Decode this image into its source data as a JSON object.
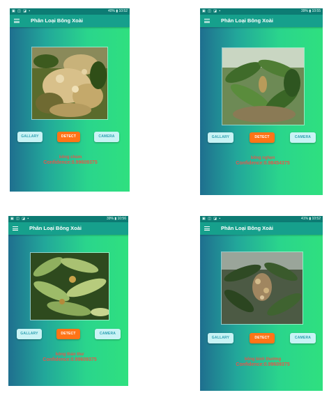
{
  "app_title": "Phân Loại Bông Xoài",
  "buttons": {
    "gallery": "GALLARY",
    "detect": "DETECT",
    "camera": "CAMERA"
  },
  "screens": [
    {
      "status_right": "40% ▮ 10:52",
      "status_left": "▣ ◫ ◪ ▪",
      "result_label": "bông chùm",
      "confidence": "Confidence:0.99609375",
      "image_desc": "mango-flower-cluster-photo"
    },
    {
      "status_right": "39% ▮ 10:55",
      "status_left": "▣ ◫ ◪ ▪",
      "result_label": "bông nghẹn",
      "confidence": "Confidence:0.98454375",
      "image_desc": "mango-leaves-bud-photo"
    },
    {
      "status_right": "39% ▮ 10:56",
      "status_left": "▣ ◫ ◪ ▪",
      "result_label": "bông thán thư",
      "confidence": "Confidence:0.99609375",
      "image_desc": "mango-leaves-disease-photo"
    },
    {
      "status_right": "41% ▮ 10:52",
      "status_left": "▣ ◫ ◪ ▪",
      "result_label": "bông bình thường",
      "confidence": "Confidence:0.99609375",
      "image_desc": "mango-normal-flower-photo"
    }
  ]
}
